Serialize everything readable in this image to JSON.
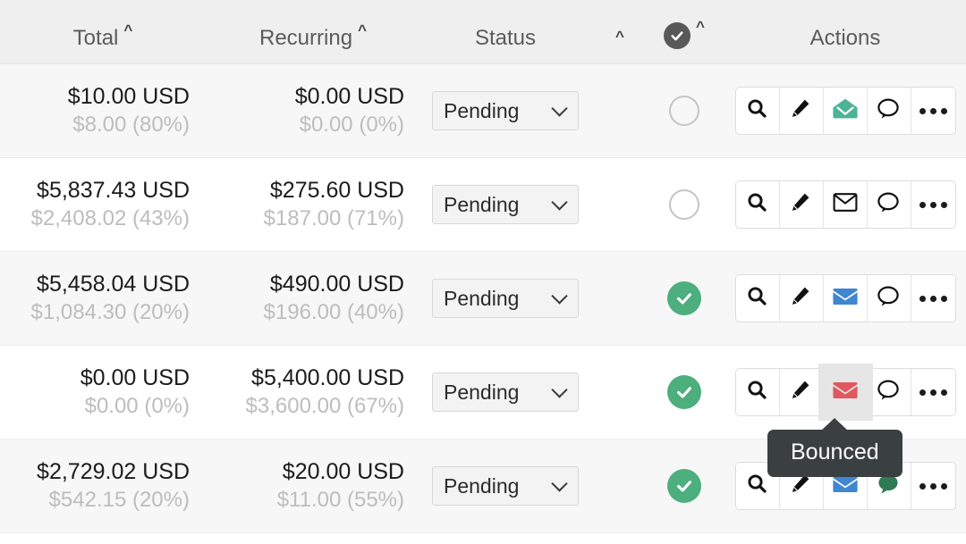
{
  "header": {
    "columns": [
      {
        "label": "Total",
        "sort_icon": "caret-up-icon",
        "sortable": true
      },
      {
        "label": "Recurring",
        "sort_icon": "caret-up-icon",
        "sortable": true
      },
      {
        "label": "Status",
        "sort_icon": "caret-up-icon",
        "sortable": true
      },
      {
        "label": "",
        "sort_icon": "caret-up-icon",
        "sortable": true,
        "icon": "check-circle-icon"
      },
      {
        "label": "Actions",
        "sort_icon": "",
        "sortable": false
      }
    ],
    "select_all_icon": "check-circle-icon",
    "background": "#efefef",
    "text_color": "#5b5b5b"
  },
  "colors": {
    "row_odd": "#f7f7f7",
    "row_even": "#ffffff",
    "check_green": "#4caf7d",
    "envelope_teal": "#4cb396",
    "envelope_blue": "#3f87d2",
    "envelope_red": "#e0585f",
    "chat_green": "#2f7a55",
    "tooltip_bg": "#3a3f41",
    "muted_text": "#bdbdbd",
    "amount_text": "#1b1b1b"
  },
  "status_options": [
    "Pending"
  ],
  "rows": [
    {
      "total": "$10.00 USD",
      "total_sub": "$8.00 (80%)",
      "recurring": "$0.00 USD",
      "recurring_sub": "$0.00 (0%)",
      "status": "Pending",
      "checked": false,
      "check_icon": "circle-empty-icon",
      "actions": [
        {
          "name": "search-icon",
          "type": "search"
        },
        {
          "name": "edit-icon",
          "type": "pencil"
        },
        {
          "name": "email-opened-icon",
          "type": "envelope-open",
          "color": "#4cb396"
        },
        {
          "name": "comment-icon",
          "type": "chat",
          "color": "none"
        },
        {
          "name": "more-icon",
          "type": "dots"
        }
      ]
    },
    {
      "total": "$5,837.43 USD",
      "total_sub": "$2,408.02 (43%)",
      "recurring": "$275.60 USD",
      "recurring_sub": "$187.00 (71%)",
      "status": "Pending",
      "checked": false,
      "check_icon": "circle-empty-icon",
      "actions": [
        {
          "name": "search-icon",
          "type": "search"
        },
        {
          "name": "edit-icon",
          "type": "pencil"
        },
        {
          "name": "email-unsent-icon",
          "type": "envelope-outline",
          "color": "none"
        },
        {
          "name": "comment-icon",
          "type": "chat",
          "color": "none"
        },
        {
          "name": "more-icon",
          "type": "dots"
        }
      ]
    },
    {
      "total": "$5,458.04 USD",
      "total_sub": "$1,084.30 (20%)",
      "recurring": "$490.00 USD",
      "recurring_sub": "$196.00 (40%)",
      "status": "Pending",
      "checked": true,
      "check_icon": "check-circle-icon",
      "actions": [
        {
          "name": "search-icon",
          "type": "search"
        },
        {
          "name": "edit-icon",
          "type": "pencil"
        },
        {
          "name": "email-sent-icon",
          "type": "envelope-filled",
          "color": "#3f87d2"
        },
        {
          "name": "comment-icon",
          "type": "chat",
          "color": "none"
        },
        {
          "name": "more-icon",
          "type": "dots"
        }
      ]
    },
    {
      "total": "$0.00 USD",
      "total_sub": "$0.00 (0%)",
      "recurring": "$5,400.00 USD",
      "recurring_sub": "$3,600.00 (67%)",
      "status": "Pending",
      "checked": true,
      "check_icon": "check-circle-icon",
      "actions": [
        {
          "name": "search-icon",
          "type": "search"
        },
        {
          "name": "edit-icon",
          "type": "pencil"
        },
        {
          "name": "email-bounced-icon",
          "type": "envelope-filled",
          "color": "#e0585f",
          "hovered": true,
          "tooltip": "Bounced"
        },
        {
          "name": "comment-icon",
          "type": "chat",
          "color": "none"
        },
        {
          "name": "more-icon",
          "type": "dots"
        }
      ]
    },
    {
      "total": "$2,729.02 USD",
      "total_sub": "$542.15 (20%)",
      "recurring": "$20.00 USD",
      "recurring_sub": "$11.00 (55%)",
      "status": "Pending",
      "checked": true,
      "check_icon": "check-circle-icon",
      "actions": [
        {
          "name": "search-icon",
          "type": "search"
        },
        {
          "name": "edit-icon",
          "type": "pencil"
        },
        {
          "name": "email-sent-icon",
          "type": "envelope-filled",
          "color": "#3f87d2"
        },
        {
          "name": "comment-icon",
          "type": "chat-filled",
          "color": "#2f7a55"
        },
        {
          "name": "more-icon",
          "type": "dots"
        }
      ]
    }
  ],
  "tooltip": {
    "text": "Bounced",
    "visible": true
  }
}
